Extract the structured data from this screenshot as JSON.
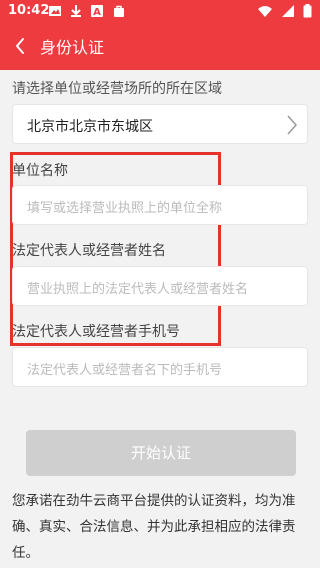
{
  "status_bar": {
    "time": "10:42",
    "left_icons": [
      "image-icon",
      "download-icon",
      "font-icon",
      "bag-icon"
    ],
    "right_icons": [
      "wifi-icon",
      "signal-icon",
      "battery-icon"
    ]
  },
  "header": {
    "title": "身份认证",
    "color": "#ee3b3f"
  },
  "region": {
    "prompt": "请选择单位或经营场所的所在区域",
    "value": "北京市北京市东城区"
  },
  "form": {
    "company_label": "单位名称",
    "company_placeholder": "填写或选择营业执照上的单位全称",
    "rep_label": "法定代表人或经营者姓名",
    "rep_placeholder": "营业执照上的法定代表人或经营者姓名",
    "phone_label": "法定代表人或经营者手机号",
    "phone_placeholder": "法定代表人或经营者名下的手机号"
  },
  "submit_label": "开始认证",
  "notice": "您承诺在劲牛云商平台提供的认证资料，均为准确、真实、合法信息、并为此承担相应的法律责任。"
}
